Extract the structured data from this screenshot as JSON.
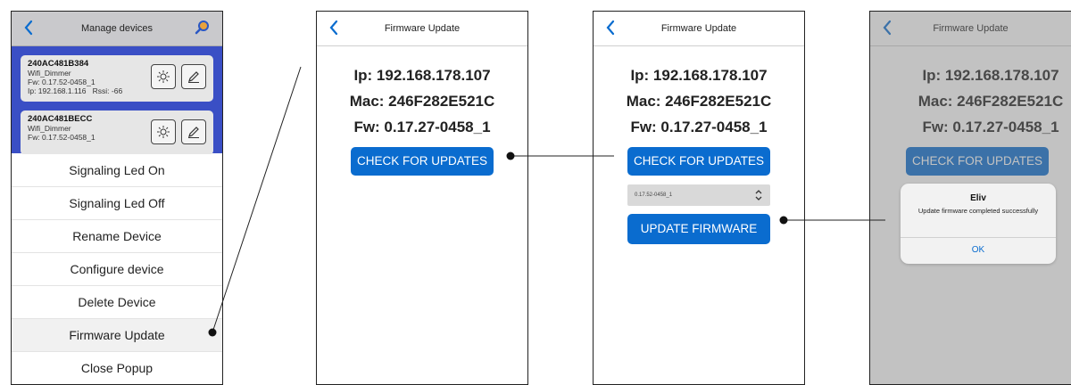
{
  "colors": {
    "accent": "#0a6ccf",
    "device_list_bg": "#3a4fc5",
    "nav_bar_dim": "#c9c9cc"
  },
  "panel1": {
    "title": "Manage devices",
    "devices": [
      {
        "id": "240AC481B384",
        "type": "Wifi_Dimmer",
        "fw": "Fw: 0.17.52-0458_1",
        "ip": "Ip: 192.168.1.116",
        "rssi": "Rssi: -66"
      },
      {
        "id": "240AC481BECC",
        "type": "Wifi_Dimmer",
        "fw": "Fw: 0.17.52-0458_1"
      }
    ],
    "menu": [
      "Signaling Led On",
      "Signaling Led Off",
      "Rename Device",
      "Configure device",
      "Delete Device",
      "Firmware Update",
      "Close Popup"
    ]
  },
  "panel2": {
    "title": "Firmware Update",
    "ip": "Ip: 192.168.178.107",
    "mac": "Mac: 246F282E521C",
    "fw": "Fw: 0.17.27-0458_1",
    "check_label": "CHECK FOR UPDATES"
  },
  "panel3": {
    "title": "Firmware Update",
    "ip": "Ip: 192.168.178.107",
    "mac": "Mac: 246F282E521C",
    "fw": "Fw: 0.17.27-0458_1",
    "check_label": "CHECK FOR UPDATES",
    "version_selected": "0.17.52-0458_1",
    "update_label": "UPDATE FIRMWARE"
  },
  "panel4": {
    "title": "Firmware Update",
    "ip": "Ip: 192.168.178.107",
    "mac": "Mac: 246F282E521C",
    "fw": "Fw: 0.17.27-0458_1",
    "check_label": "CHECK FOR UPDATES",
    "dialog": {
      "title": "Eliv",
      "message": "Update firmware completed successfully",
      "ok": "OK"
    }
  }
}
